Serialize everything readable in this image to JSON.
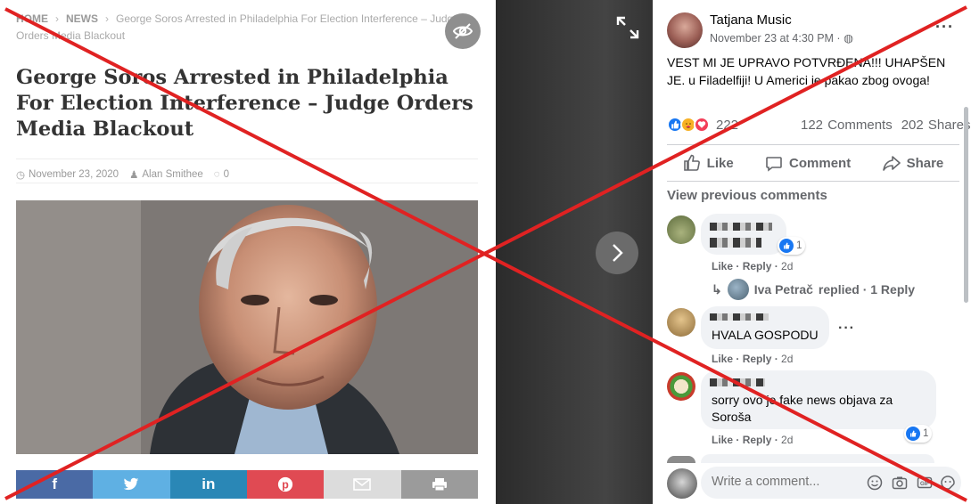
{
  "article": {
    "breadcrumb": {
      "home": "HOME",
      "section": "NEWS",
      "current": "George Soros Arrested in Philadelphia For Election Interference – Judge Orders Media Blackout"
    },
    "title": "George Soros Arrested in Philadelphia For Election Interference – Judge Orders Media Blackout",
    "date": "November 23, 2020",
    "author": "Alan Smithee",
    "comments": "0",
    "share_buttons": [
      {
        "icon": "facebook-icon",
        "glyph": "f",
        "color": "#4a6aa5"
      },
      {
        "icon": "twitter-icon",
        "glyph": "🐦",
        "color": "#5fb0e3"
      },
      {
        "icon": "linkedin-icon",
        "glyph": "in",
        "color": "#2a87b6"
      },
      {
        "icon": "pinterest-icon",
        "glyph": "℗",
        "color": "#e04a53"
      },
      {
        "icon": "email-icon",
        "glyph": "✉",
        "color": "#c9c9c9"
      },
      {
        "icon": "print-icon",
        "glyph": "⎙",
        "color": "#9b9b9b"
      }
    ]
  },
  "post": {
    "author": "Tatjana Music",
    "time": "November 23 at 4:30 PM · ",
    "text": "VEST MI JE UPRAVO POTVRĐENA!!! UHAPŠEN JE. u Filadelfiji! U Americi je pakao zbog ovoga!",
    "reaction_count": "222",
    "comments_count": "122 Comments",
    "shares_count": "202 Shares",
    "actions": {
      "like": "Like",
      "comment": "Comment",
      "share": "Share"
    },
    "view_previous": "View previous comments"
  },
  "comments": [
    {
      "text": "",
      "like": "Like",
      "reply": "Reply",
      "age": "2d",
      "likes": "1"
    },
    {
      "text": "HVALA GOSPODU",
      "like": "Like",
      "reply": "Reply",
      "age": "2d"
    },
    {
      "text": "sorry ovo je fake news objava za Soroša",
      "like": "Like",
      "reply": "Reply",
      "age": "2d",
      "likes": "1"
    }
  ],
  "reply_summary": {
    "name": "Iva Petrač",
    "text": "replied · 1 Reply"
  },
  "composer": {
    "placeholder": "Write a comment..."
  },
  "colors": {
    "facebook_blue": "#1877f2",
    "cross_red": "#e02222",
    "viewer_dark": "#333333"
  }
}
